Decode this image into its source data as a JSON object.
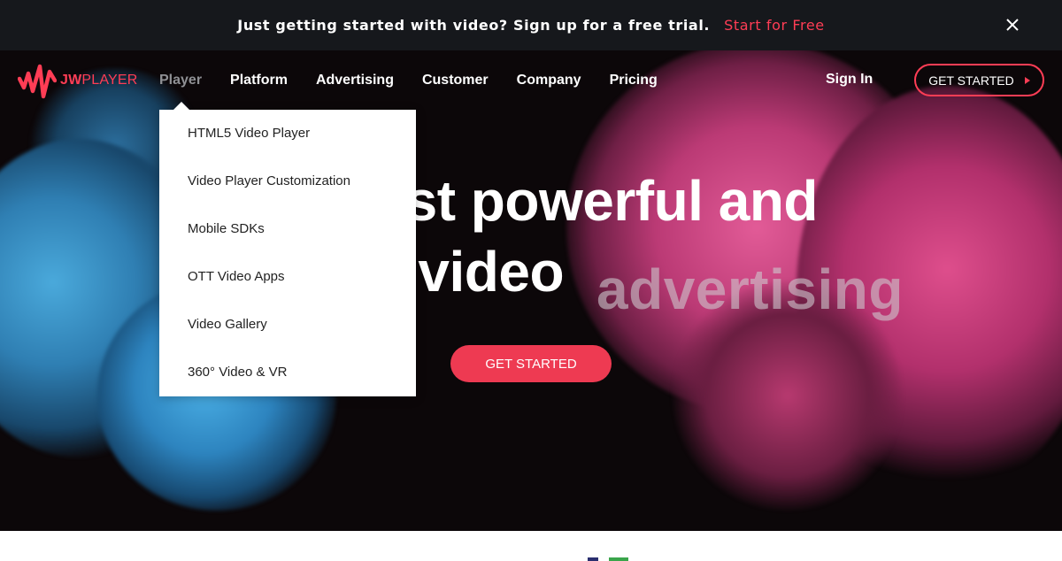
{
  "announcement": {
    "message": "Just getting started with video? Sign up for a free trial.",
    "cta": "Start for Free",
    "close_icon": "close-icon"
  },
  "brand": {
    "logo_bold": "JW",
    "logo_light": "PLAYER",
    "accent_color": "#ff3d55"
  },
  "nav": {
    "items": [
      {
        "label": "Player",
        "active": true
      },
      {
        "label": "Platform"
      },
      {
        "label": "Advertising"
      },
      {
        "label": "Customer"
      },
      {
        "label": "Company"
      },
      {
        "label": "Pricing"
      }
    ],
    "sign_in": "Sign In",
    "get_started": "GET STARTED"
  },
  "player_menu": {
    "items": [
      "HTML5 Video Player",
      "Video Player Customization",
      "Mobile SDKs",
      "OTT Video Apps",
      "Video Gallery",
      "360° Video & VR"
    ]
  },
  "hero": {
    "line1_visible": "ost powerful and",
    "line2_visible": "e video",
    "rotating_word": "advertising",
    "cta": "GET STARTED"
  }
}
